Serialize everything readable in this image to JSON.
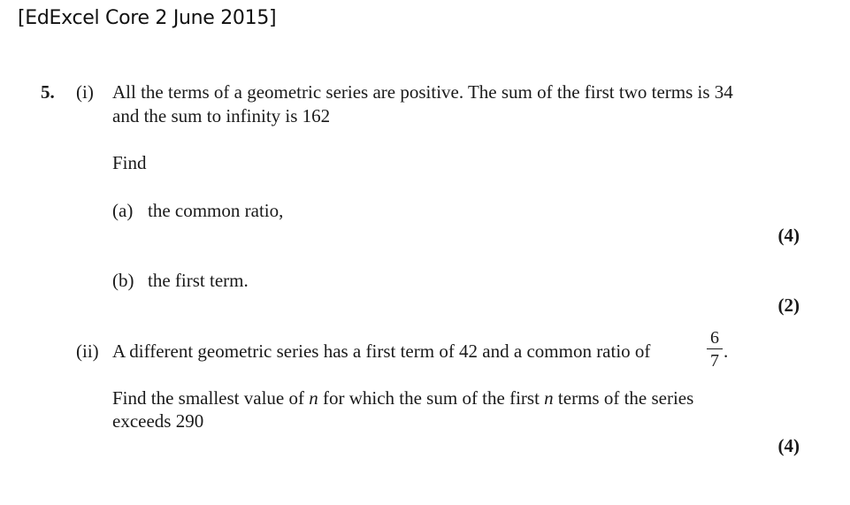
{
  "header": {
    "source": "[EdExcel Core 2 June 2015]"
  },
  "question": {
    "number": "5.",
    "part_i": {
      "label": "(i)",
      "line1": "All the terms of a geometric series are positive.  The sum of the first two terms is 34",
      "line2": "and the sum to infinity is 162",
      "find": "Find",
      "a_label": "(a)",
      "a_text": "the common ratio,",
      "a_marks": "(4)",
      "b_label": "(b)",
      "b_text": "the first term.",
      "b_marks": "(2)"
    },
    "part_ii": {
      "label": "(ii)",
      "line1": "A different geometric series has a first term of 42 and a common ratio of",
      "ratio_num": "6",
      "ratio_den": "7",
      "line1_end": ".",
      "line2_pre": "Find the smallest value of ",
      "var_n": "n",
      "line2_mid": " for which the sum of the first ",
      "line2_post": " terms of the series",
      "line3": "exceeds 290",
      "marks": "(4)"
    }
  }
}
